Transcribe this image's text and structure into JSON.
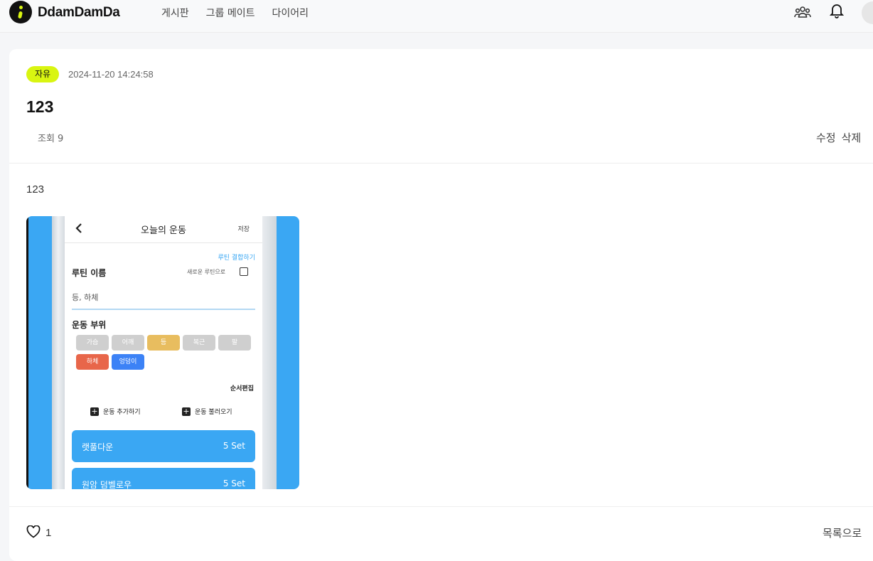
{
  "header": {
    "brand": "DdamDamDa",
    "nav": [
      "게시판",
      "그룹 메이트",
      "다이어리"
    ]
  },
  "post": {
    "category": "자유",
    "date": "2024-11-20 14:24:58",
    "title": "123",
    "views": "조회 9",
    "edit_label": "수정",
    "delete_label": "삭제",
    "content": "123",
    "likes": "1",
    "list_label": "목록으로"
  },
  "attachment": {
    "screen_title": "오늘의 운동",
    "save": "저장",
    "routine_link": "루틴 결합하기",
    "routine_name_label": "루틴 이름",
    "new_routine_label": "새로운 루틴으로",
    "routine_name_value": "등, 하체",
    "body_part_label": "운동 부위",
    "chips": [
      {
        "label": "가슴",
        "color": "#cfcfcf"
      },
      {
        "label": "어깨",
        "color": "#cfcfcf"
      },
      {
        "label": "등",
        "color": "#e8bd5f"
      },
      {
        "label": "복근",
        "color": "#cfcfcf"
      },
      {
        "label": "팔",
        "color": "#cfcfcf"
      },
      {
        "label": "하체",
        "color": "#e8664a"
      },
      {
        "label": "엉덩이",
        "color": "#3c82f6"
      }
    ],
    "reorder_label": "순서편집",
    "add_exercise": "운동 추가하기",
    "load_exercise": "운동 불러오기",
    "exercises": [
      {
        "name": "랫풀다운",
        "sets": "5 Set"
      },
      {
        "name": "원암 덤벨로우",
        "sets": "5 Set"
      }
    ]
  },
  "colors": {
    "accent": "#d9f511",
    "image_blue": "#3aa7f3"
  },
  "icons": [
    "group-icon",
    "bell-icon",
    "heart-icon",
    "chevron-left-icon"
  ]
}
